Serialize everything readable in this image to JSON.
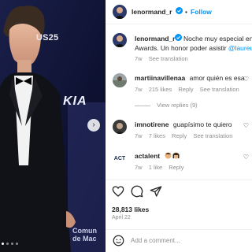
{
  "media": {
    "wall_text": "US25",
    "sponsor_text": "KIA",
    "bottom_text_line1": "Comun",
    "bottom_text_line2": "de Mac"
  },
  "header": {
    "username": "lenormand_r",
    "dot": "•",
    "follow_label": "Follow"
  },
  "caption": {
    "username": "lenormand_r",
    "text_line1": "Noche muy especial en l",
    "text_line2": "Awards. Un honor poder asistir",
    "mention": "@laureus",
    "time": "7w",
    "see_translation": "See translation"
  },
  "comments": [
    {
      "username": "martiinavillenaa",
      "text": "amor quién es esa",
      "time": "7w",
      "likes": "215 likes",
      "reply": "Reply",
      "see_translation": "See translation",
      "view_replies": "View replies (9)"
    },
    {
      "username": "imnotirene",
      "text": "guapísimo te quiero",
      "time": "7w",
      "likes": "7 likes",
      "reply": "Reply",
      "see_translation": "See translation"
    },
    {
      "username": "actalent",
      "avatar_text": "ACT",
      "time": "7w",
      "likes": "1 like",
      "reply": "Reply"
    }
  ],
  "footer": {
    "likes": "28,813 likes",
    "date": "April 22",
    "add_comment_placeholder": "Add a comment..."
  },
  "colors": {
    "accent": "#0095f6",
    "text": "#262626",
    "muted": "#8e8e8e"
  }
}
